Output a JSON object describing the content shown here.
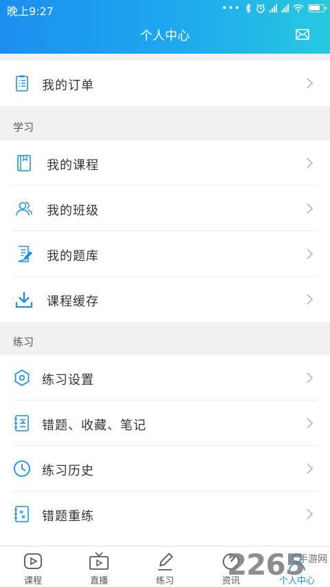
{
  "status_bar": {
    "time": "晚上9:27"
  },
  "header": {
    "title": "个人中心"
  },
  "order": {
    "label": "我的订单"
  },
  "sections": {
    "study": {
      "title": "学习",
      "items": [
        {
          "label": "我的课程"
        },
        {
          "label": "我的班级"
        },
        {
          "label": "我的题库"
        },
        {
          "label": "课程缓存"
        }
      ]
    },
    "practice": {
      "title": "练习",
      "items": [
        {
          "label": "练习设置"
        },
        {
          "label": "错题、收藏、笔记"
        },
        {
          "label": "练习历史"
        },
        {
          "label": "错题重练"
        }
      ]
    }
  },
  "tabbar": {
    "tabs": [
      {
        "label": "课程"
      },
      {
        "label": "直播"
      },
      {
        "label": "练习"
      },
      {
        "label": "资讯"
      },
      {
        "label": "个人中心"
      }
    ],
    "active_color": "#1a8ff0"
  },
  "watermark": {
    "number": "2265",
    "text": "手游网"
  },
  "colors": {
    "accent": "#1a8ff0",
    "header_start": "#1a8ff0",
    "header_end": "#27c9e0"
  }
}
